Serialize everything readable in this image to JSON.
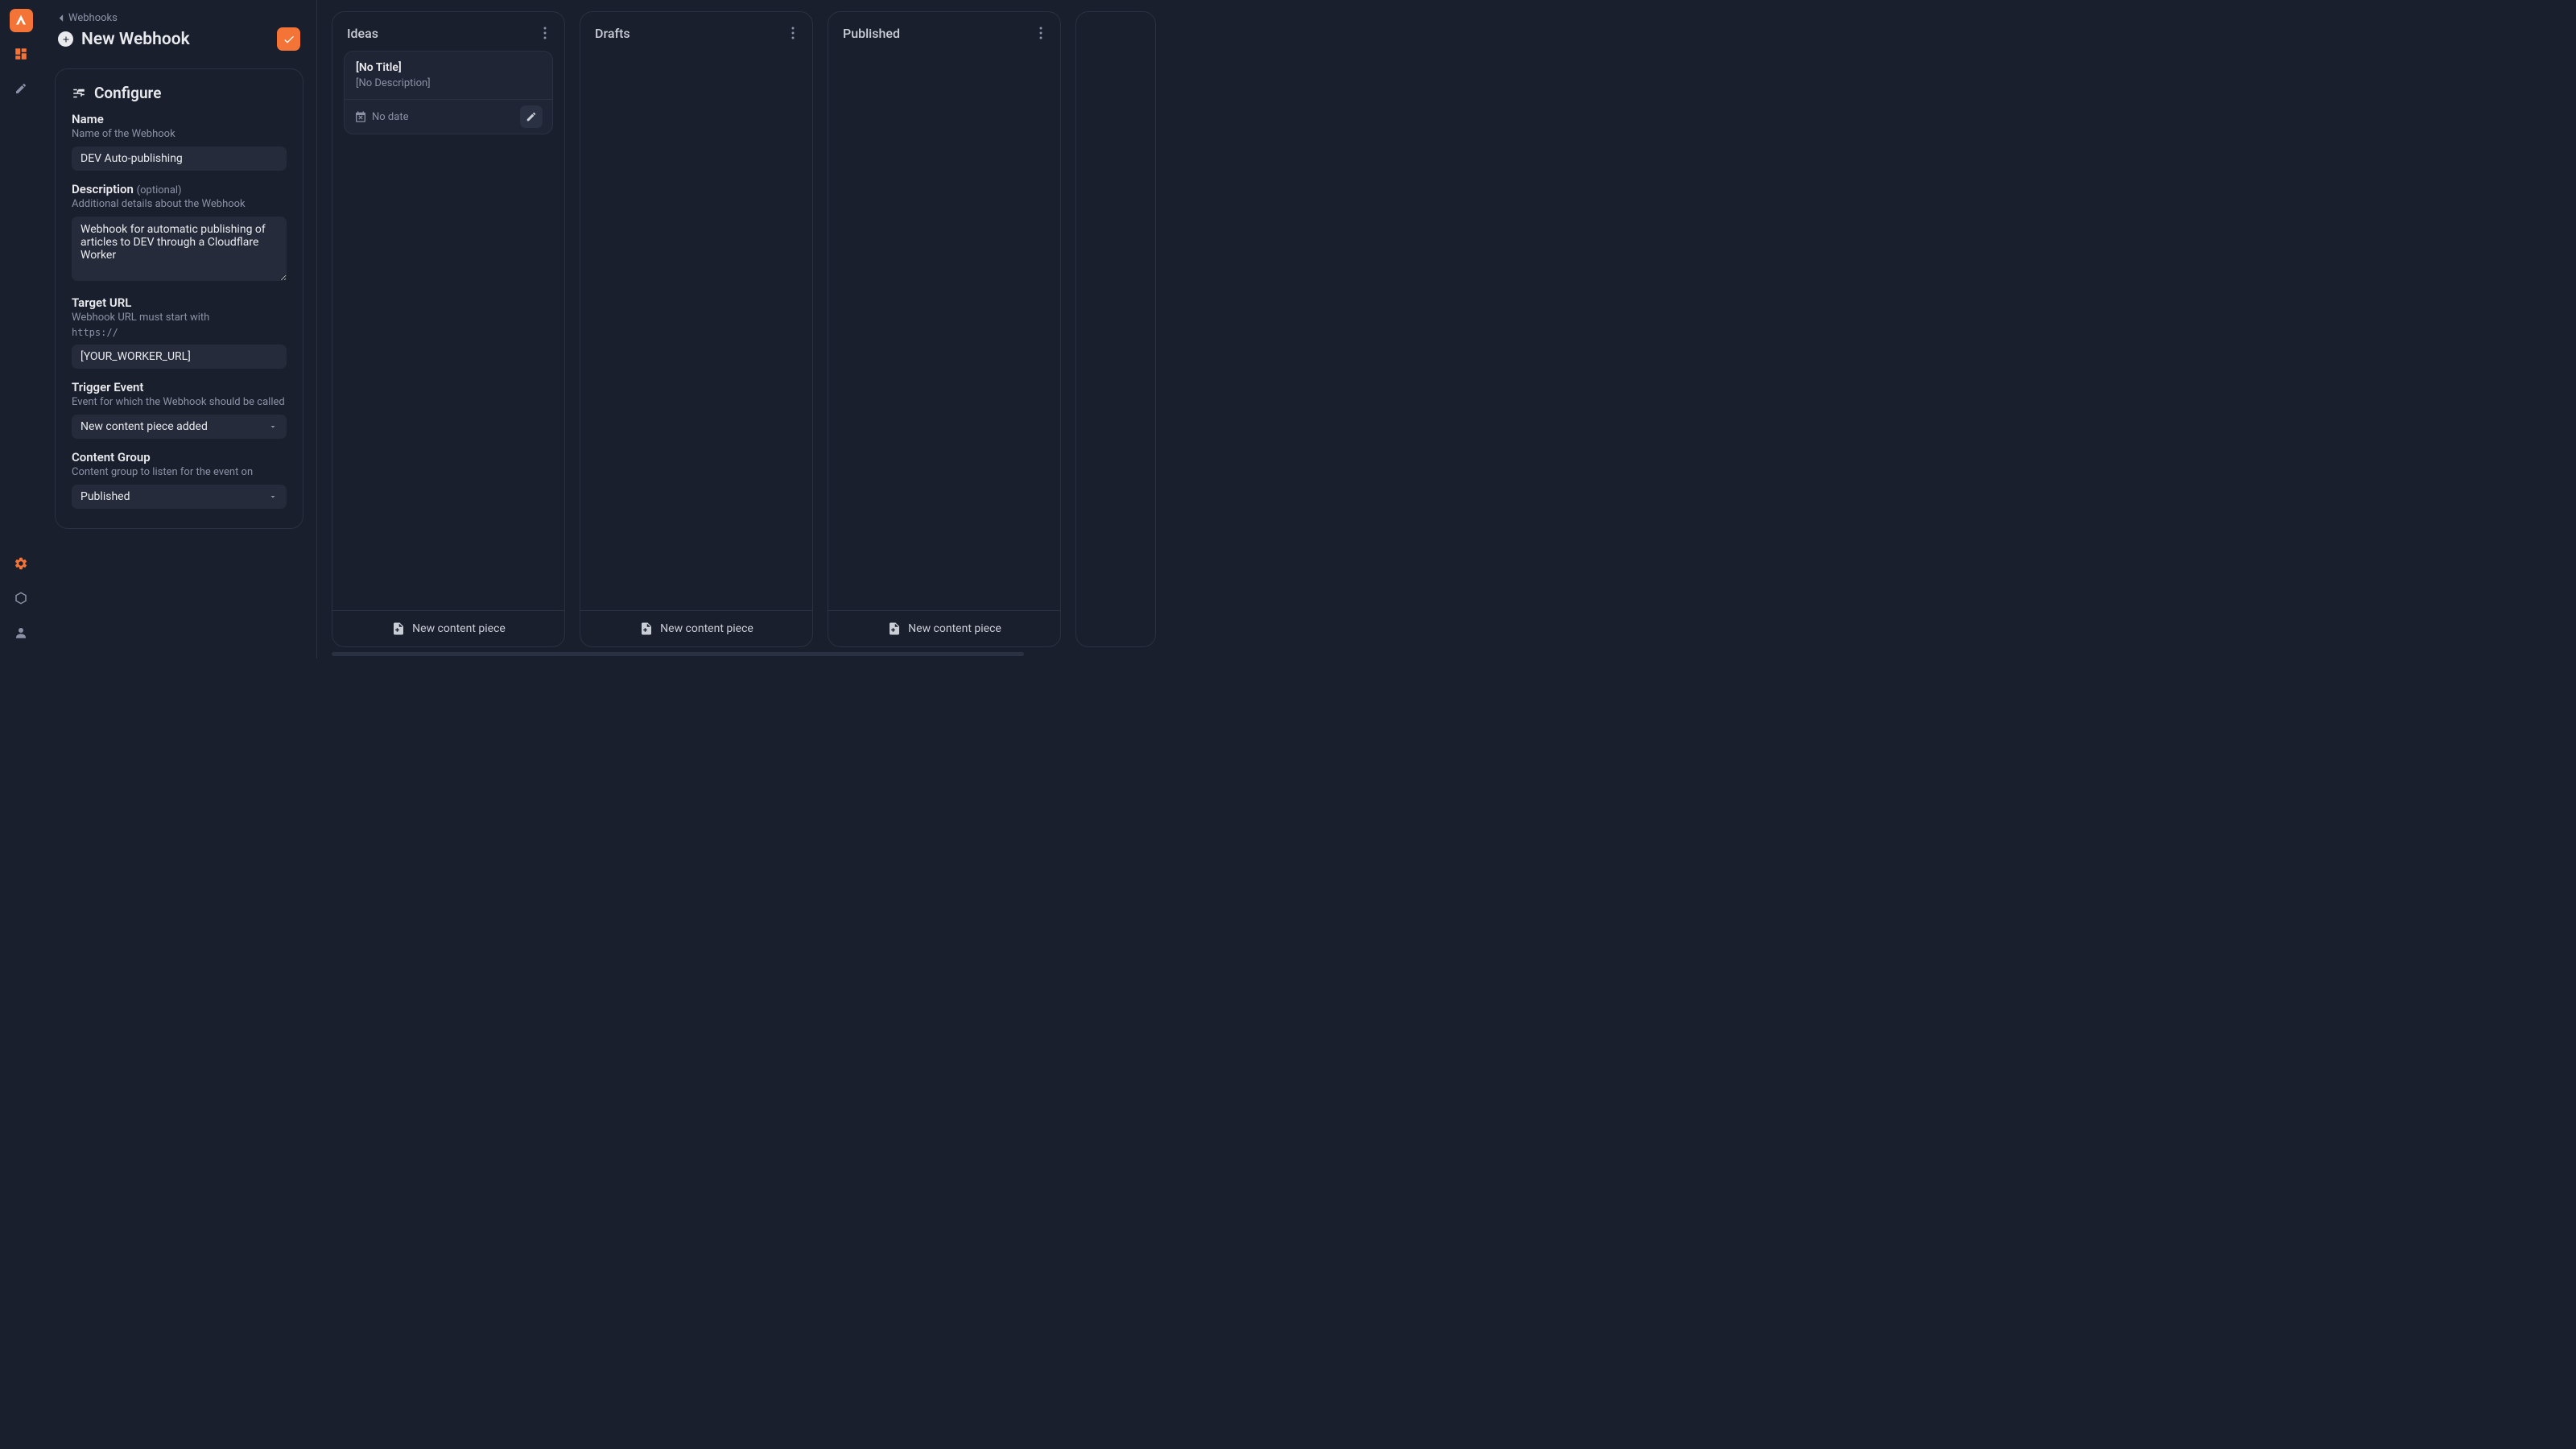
{
  "breadcrumb": {
    "label": "Webhooks"
  },
  "page": {
    "title": "New Webhook"
  },
  "configure": {
    "title": "Configure",
    "name": {
      "label": "Name",
      "sublabel": "Name of the Webhook",
      "value": "DEV Auto-publishing"
    },
    "description": {
      "label": "Description",
      "optional": "(optional)",
      "sublabel": "Additional details about the Webhook",
      "value": "Webhook for automatic publishing of articles to DEV through a Cloudflare Worker"
    },
    "target_url": {
      "label": "Target URL",
      "sublabel": "Webhook URL must start with",
      "sublabel_code": "https://",
      "value": "[YOUR_WORKER_URL]"
    },
    "trigger_event": {
      "label": "Trigger Event",
      "sublabel": "Event for which the Webhook should be called",
      "value": "New content piece added"
    },
    "content_group": {
      "label": "Content Group",
      "sublabel": "Content group to listen for the event on",
      "value": "Published"
    }
  },
  "columns": [
    {
      "title": "Ideas",
      "cards": [
        {
          "title": "[No Title]",
          "description": "[No Description]",
          "date": "No date"
        }
      ]
    },
    {
      "title": "Drafts",
      "cards": []
    },
    {
      "title": "Published",
      "cards": []
    }
  ],
  "actions": {
    "new_content_piece": "New content piece"
  }
}
